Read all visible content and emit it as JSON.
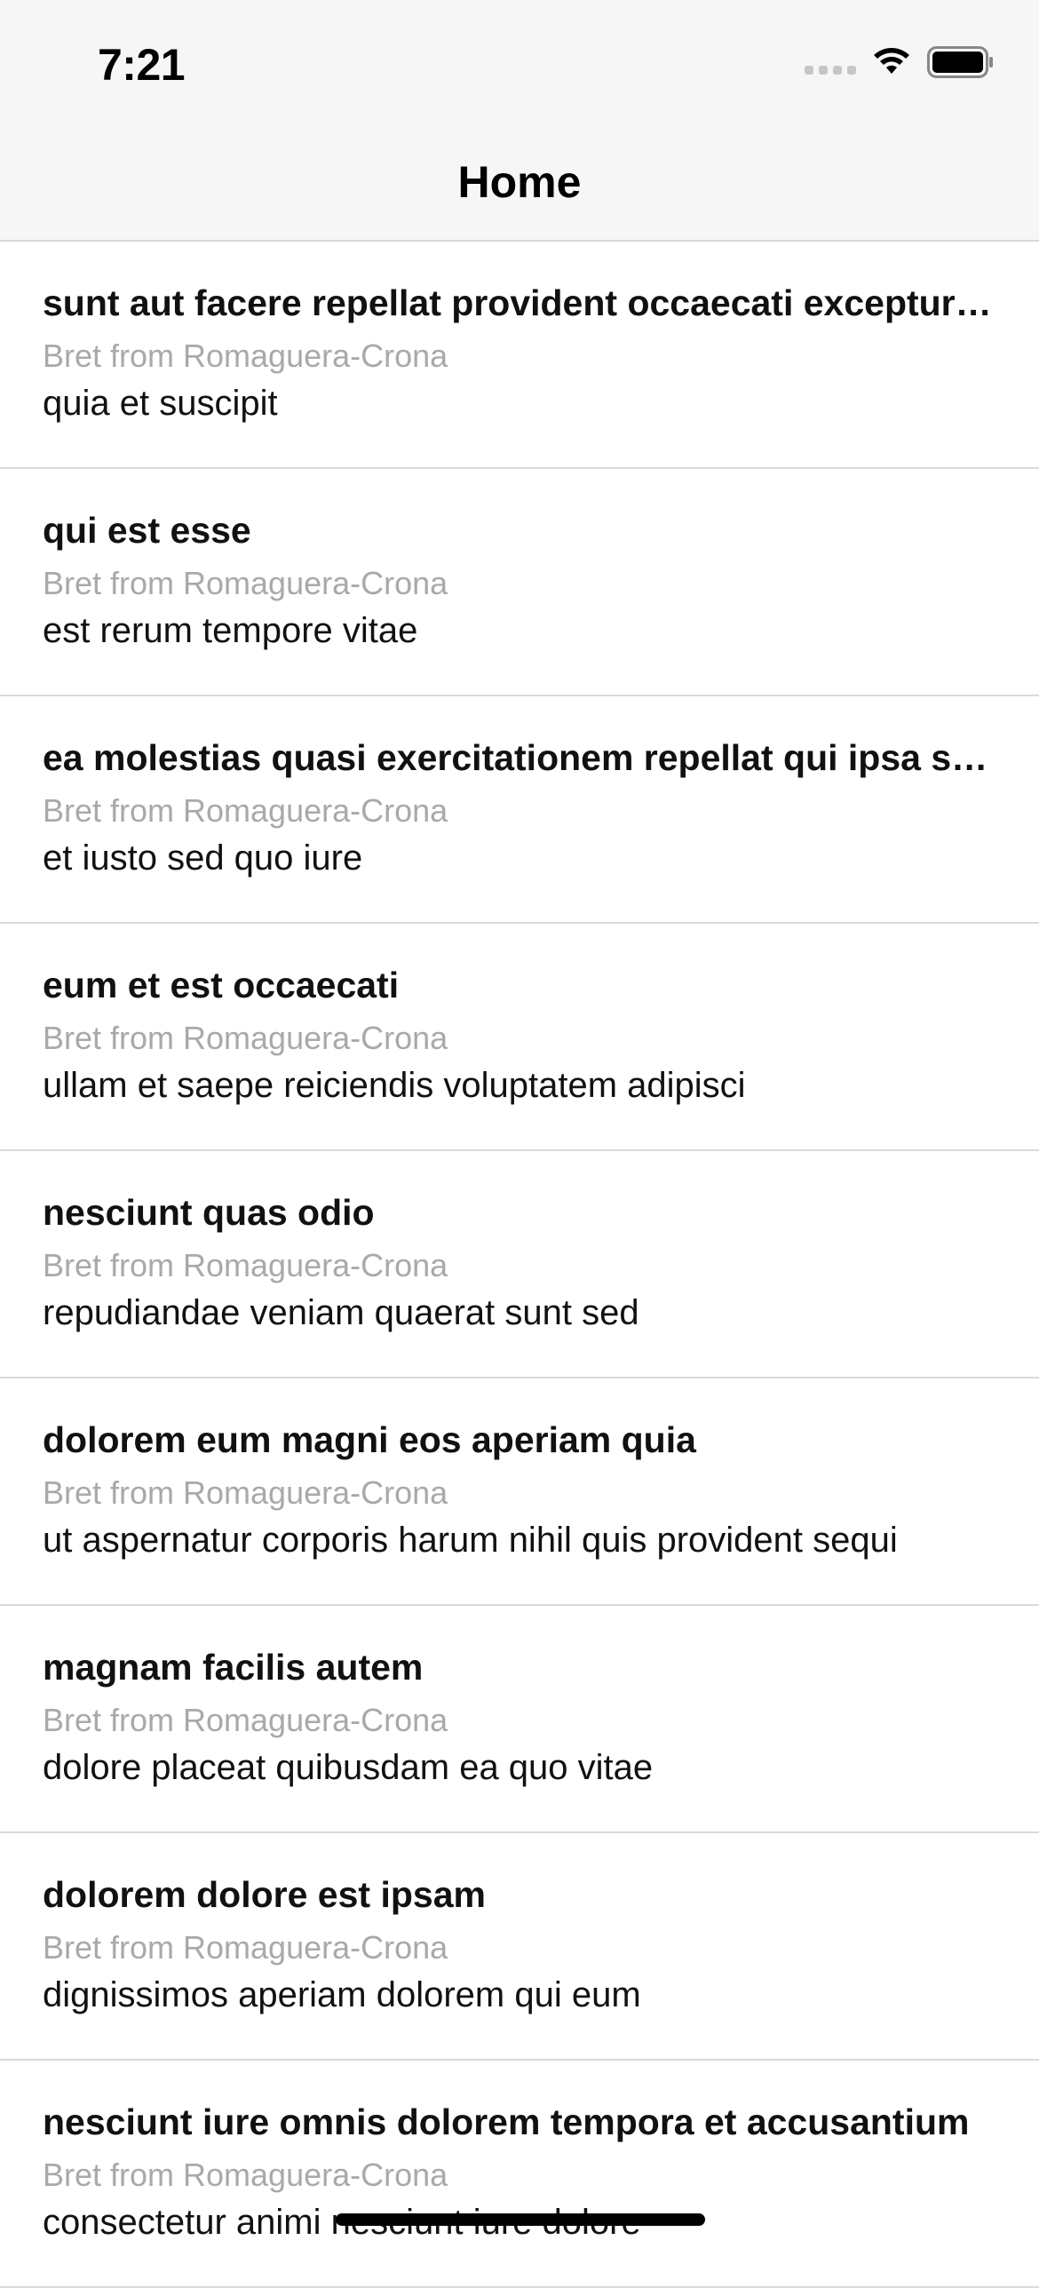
{
  "status_bar": {
    "time": "7:21",
    "icons": [
      "cellular-signal-icon",
      "wifi-icon",
      "battery-icon"
    ]
  },
  "nav": {
    "title": "Home"
  },
  "posts": [
    {
      "title": "sunt aut facere repellat provident occaecati excepturi optio reprehenderit",
      "author": "Bret from Romaguera-Crona",
      "body": "quia et suscipit"
    },
    {
      "title": "qui est esse",
      "author": "Bret from Romaguera-Crona",
      "body": "est rerum tempore vitae"
    },
    {
      "title": "ea molestias quasi exercitationem repellat qui ipsa sit aut",
      "author": "Bret from Romaguera-Crona",
      "body": "et iusto sed quo iure"
    },
    {
      "title": "eum et est occaecati",
      "author": "Bret from Romaguera-Crona",
      "body": "ullam et saepe reiciendis voluptatem adipisci"
    },
    {
      "title": "nesciunt quas odio",
      "author": "Bret from Romaguera-Crona",
      "body": "repudiandae veniam quaerat sunt sed"
    },
    {
      "title": "dolorem eum magni eos aperiam quia",
      "author": "Bret from Romaguera-Crona",
      "body": "ut aspernatur corporis harum nihil quis provident sequi"
    },
    {
      "title": "magnam facilis autem",
      "author": "Bret from Romaguera-Crona",
      "body": "dolore placeat quibusdam ea quo vitae"
    },
    {
      "title": "dolorem dolore est ipsam",
      "author": "Bret from Romaguera-Crona",
      "body": "dignissimos aperiam dolorem qui eum"
    },
    {
      "title": "nesciunt iure omnis dolorem tempora et accusantium",
      "author": "Bret from Romaguera-Crona",
      "body": "consectetur animi nesciunt iure dolore"
    }
  ],
  "colors": {
    "bar_background": "#f6f6f6",
    "separator": "#dadada",
    "author_text": "#a9a9a9",
    "primary_text": "#111111"
  }
}
